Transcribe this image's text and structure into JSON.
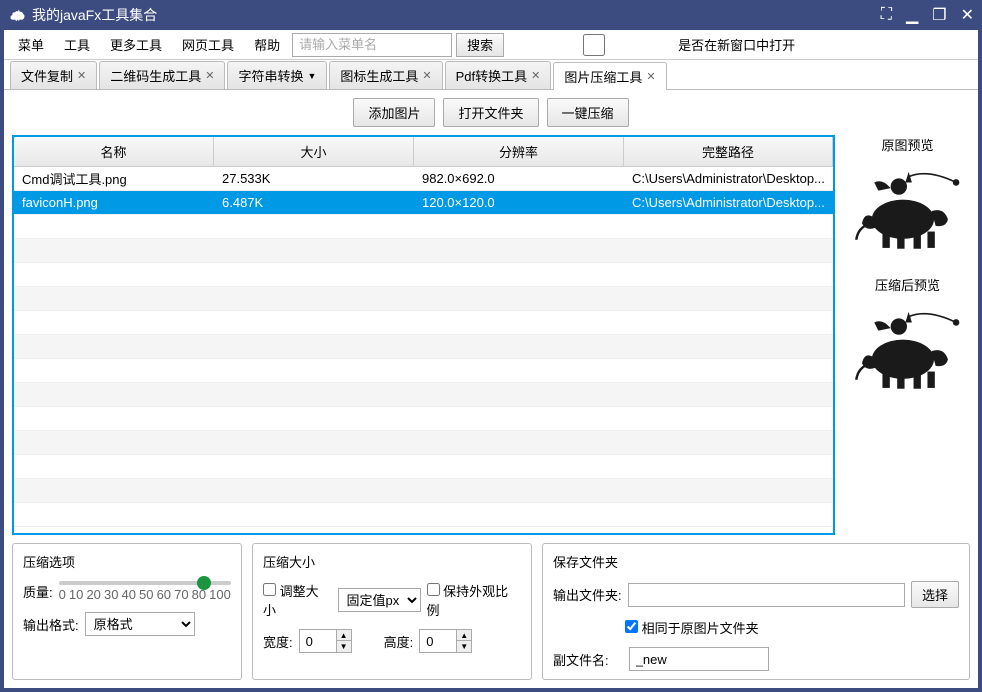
{
  "window": {
    "title": "我的javaFx工具集合"
  },
  "menubar": {
    "items": [
      "菜单",
      "工具",
      "更多工具",
      "网页工具",
      "帮助"
    ],
    "search_placeholder": "请输入菜单名",
    "search_btn": "搜索",
    "new_window_label": "是否在新窗口中打开"
  },
  "tabs": [
    {
      "label": "文件复制"
    },
    {
      "label": "二维码生成工具"
    },
    {
      "label": "字符串转换"
    },
    {
      "label": "图标生成工具"
    },
    {
      "label": "Pdf转换工具"
    },
    {
      "label": "图片压缩工具",
      "active": true
    }
  ],
  "toolbar": {
    "add_image": "添加图片",
    "open_folder": "打开文件夹",
    "compress_all": "一键压缩"
  },
  "table": {
    "headers": {
      "name": "名称",
      "size": "大小",
      "resolution": "分辨率",
      "path": "完整路径"
    },
    "rows": [
      {
        "name": "Cmd调试工具.png",
        "size": "27.533K",
        "resolution": "982.0×692.0",
        "path": "C:\\Users\\Administrator\\Desktop...",
        "selected": false
      },
      {
        "name": "faviconH.png",
        "size": "6.487K",
        "resolution": "120.0×120.0",
        "path": "C:\\Users\\Administrator\\Desktop...",
        "selected": true
      }
    ]
  },
  "side": {
    "original_preview": "原图预览",
    "compressed_preview": "压缩后预览"
  },
  "compress_options": {
    "title": "压缩选项",
    "quality_label": "质量:",
    "slider_ticks": [
      "0",
      "10",
      "20",
      "30",
      "40",
      "50",
      "60",
      "70",
      "80",
      "100"
    ],
    "output_format_label": "输出格式:",
    "output_format_value": "原格式"
  },
  "compress_size": {
    "title": "压缩大小",
    "resize_label": "调整大小",
    "fixed_px": "固定值px",
    "keep_ratio": "保持外观比例",
    "width_label": "宽度:",
    "width_value": "0",
    "height_label": "高度:",
    "height_value": "0"
  },
  "save_folder": {
    "title": "保存文件夹",
    "output_folder_label": "输出文件夹:",
    "select_btn": "选择",
    "same_as_source": "相同于原图片文件夹",
    "suffix_label": "副文件名:",
    "suffix_value": "_new"
  }
}
